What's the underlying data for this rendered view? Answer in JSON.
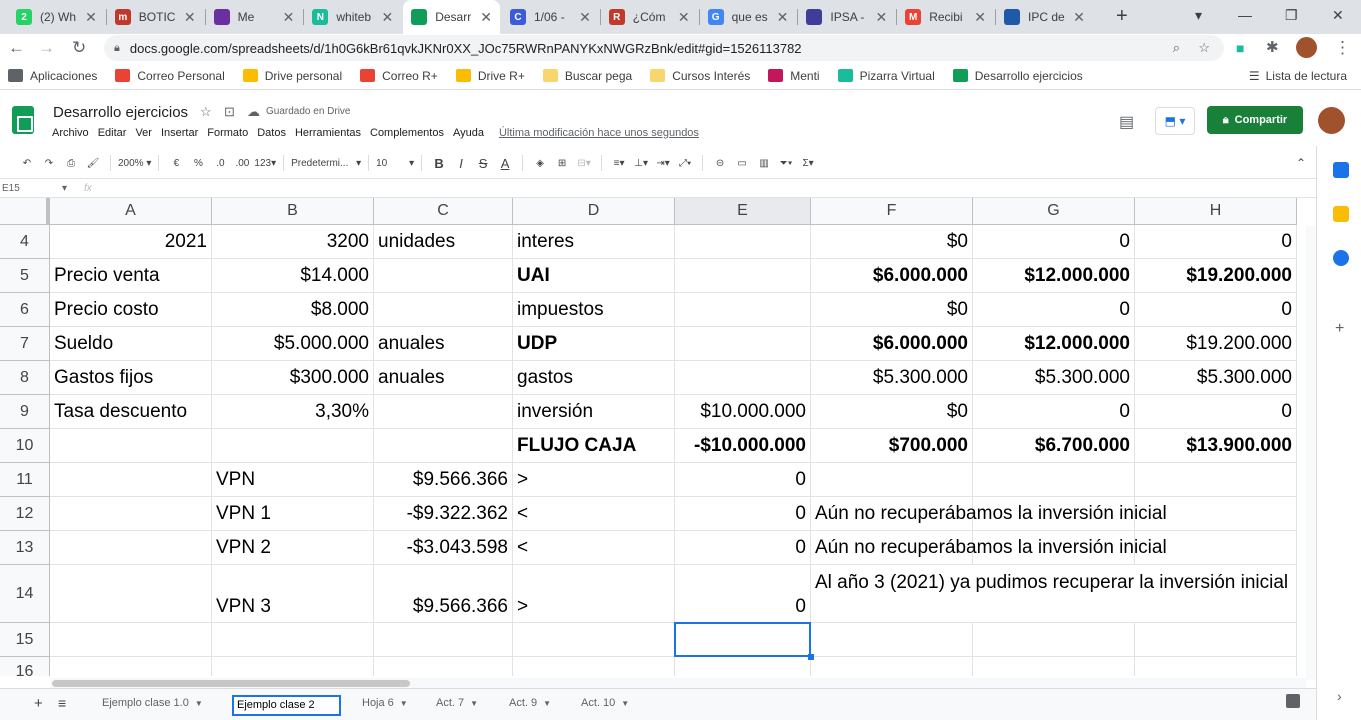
{
  "browser": {
    "tabs": [
      {
        "label": "(2) Wh",
        "fav_text": "2",
        "fav_color": "#25d366"
      },
      {
        "label": "BOTIC",
        "fav_text": "m",
        "fav_color": "#c0392b"
      },
      {
        "label": "Me",
        "fav_text": "",
        "fav_color": "#6b2fa0"
      },
      {
        "label": "whiteb",
        "fav_text": "N",
        "fav_color": "#1abc9c"
      },
      {
        "label": "Desarr",
        "fav_text": "",
        "fav_color": "#0f9d58"
      },
      {
        "label": "1/06 -",
        "fav_text": "C",
        "fav_color": "#3b5bdb"
      },
      {
        "label": "¿Cóm",
        "fav_text": "R",
        "fav_color": "#c0392b"
      },
      {
        "label": "que es",
        "fav_text": "G",
        "fav_color": "#4285f4"
      },
      {
        "label": "IPSA -",
        "fav_text": "",
        "fav_color": "#3f3d99"
      },
      {
        "label": "Recibi",
        "fav_text": "M",
        "fav_color": "#ea4335"
      },
      {
        "label": "IPC de",
        "fav_text": "",
        "fav_color": "#1e5aa8"
      }
    ],
    "url": "docs.google.com/spreadsheets/d/1h0G6kBr61qvkJKNr0XX_JOc75RWRnPANYKxNWGRzBnk/edit#gid=1526113782",
    "bookmarks": [
      {
        "label": "Aplicaciones",
        "color": "#5f6368"
      },
      {
        "label": "Correo Personal",
        "color": "#ea4335"
      },
      {
        "label": "Drive personal",
        "color": "#fbbc04"
      },
      {
        "label": "Correo R+",
        "color": "#ea4335"
      },
      {
        "label": "Drive R+",
        "color": "#fbbc04"
      },
      {
        "label": "Buscar pega",
        "color": "#f9d56e"
      },
      {
        "label": "Cursos Interés",
        "color": "#f9d56e"
      },
      {
        "label": "Menti",
        "color": "#c2185b"
      },
      {
        "label": "Pizarra Virtual",
        "color": "#1abc9c"
      },
      {
        "label": "Desarrollo ejercicios",
        "color": "#0f9d58"
      }
    ],
    "reading_list": "Lista de lectura"
  },
  "doc": {
    "title": "Desarrollo ejercicios",
    "saved": "Guardado en Drive",
    "menu": [
      "Archivo",
      "Editar",
      "Ver",
      "Insertar",
      "Formato",
      "Datos",
      "Herramientas",
      "Complementos",
      "Ayuda"
    ],
    "last_edit": "Última modificación hace unos segundos",
    "share": "Compartir"
  },
  "toolbar": {
    "zoom": "200%",
    "currency": "€",
    "percent": "%",
    "dec_less": ".0",
    "dec_more": ".00",
    "format_more": "123",
    "font": "Predetermi...",
    "size": "10"
  },
  "formula": {
    "cell_ref": "E15",
    "fx": "fx",
    "content": ""
  },
  "grid": {
    "columns": [
      "A",
      "B",
      "C",
      "D",
      "E",
      "F",
      "G",
      "H"
    ],
    "rows": [
      {
        "num": "4",
        "cells": [
          "2021",
          "3200",
          "unidades",
          "interes",
          "",
          "$0",
          "0",
          "0"
        ]
      },
      {
        "num": "5",
        "cells": [
          "Precio venta",
          "$14.000",
          "",
          "UAI",
          "",
          "$6.000.000",
          "$12.000.000",
          "$19.200.000"
        ]
      },
      {
        "num": "6",
        "cells": [
          "Precio costo",
          "$8.000",
          "",
          "impuestos",
          "",
          "$0",
          "0",
          "0"
        ]
      },
      {
        "num": "7",
        "cells": [
          "Sueldo",
          "$5.000.000",
          "anuales",
          "UDP",
          "",
          "$6.000.000",
          "$12.000.000",
          "$19.200.000"
        ]
      },
      {
        "num": "8",
        "cells": [
          "Gastos fijos",
          "$300.000",
          "anuales",
          "gastos",
          "",
          "$5.300.000",
          "$5.300.000",
          "$5.300.000"
        ]
      },
      {
        "num": "9",
        "cells": [
          "Tasa descuento",
          "3,30%",
          "",
          "inversión",
          "$10.000.000",
          "$0",
          "0",
          "0"
        ]
      },
      {
        "num": "10",
        "cells": [
          "",
          "",
          "",
          "FLUJO CAJA",
          "-$10.000.000",
          "$700.000",
          "$6.700.000",
          "$13.900.000"
        ]
      },
      {
        "num": "11",
        "cells": [
          "",
          "VPN",
          "$9.566.366",
          ">",
          "0",
          "",
          "",
          ""
        ]
      },
      {
        "num": "12",
        "cells": [
          "",
          "VPN 1",
          "-$9.322.362",
          "<",
          "0",
          "Aún no recuperábamos la inversión inicial",
          "",
          ""
        ]
      },
      {
        "num": "13",
        "cells": [
          "",
          "VPN 2",
          "-$3.043.598",
          "<",
          "0",
          "Aún no recuperábamos la inversión inicial",
          "",
          ""
        ]
      },
      {
        "num": "14",
        "cells": [
          "",
          "VPN 3",
          "$9.566.366",
          ">",
          "0",
          "Al año 3 (2021) ya pudimos recuperar la inversión inicial",
          "",
          ""
        ]
      },
      {
        "num": "15",
        "cells": [
          "",
          "",
          "",
          "",
          "",
          "",
          "",
          ""
        ]
      },
      {
        "num": "16",
        "cells": [
          "",
          "",
          "",
          "",
          "",
          "",
          "",
          ""
        ]
      }
    ],
    "selected": "E15"
  },
  "sheets": {
    "tabs": [
      "Ejemplo clase 1.0",
      "Hoja 6",
      "Act. 7",
      "Act. 9",
      "Act. 10"
    ],
    "rename_value": "Ejemplo clase 2"
  }
}
